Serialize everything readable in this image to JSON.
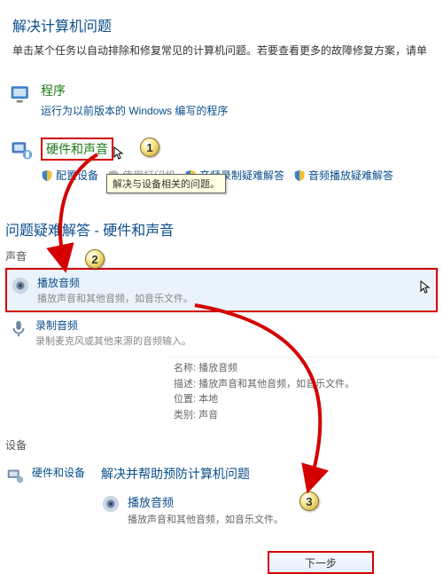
{
  "header": {
    "title": "解决计算机问题",
    "subtitle": "单击某个任务以自动排除和修复常见的计算机问题。若要查看更多的故障修复方案，请单"
  },
  "programs": {
    "title": "程序",
    "desc": "运行为以前版本的 Windows 编写的程序"
  },
  "hardware": {
    "title": "硬件和声音",
    "links": {
      "a": "配置设备",
      "b": "使用打印机",
      "c": "音频录制疑难解答",
      "d": "音频播放疑难解答"
    },
    "tooltip": "解决与设备相关的问题。"
  },
  "panel": {
    "heading": "问题疑难解答 - 硬件和声音",
    "sound_label": "声音",
    "play": {
      "title": "播放音频",
      "desc": "播放声音和其他音频，如音乐文件。"
    },
    "record": {
      "title": "录制音频",
      "desc": "录制麦克风或其他来源的音频输入。"
    },
    "device_label": "设备",
    "hwdev": {
      "title": "硬件和设备"
    },
    "detail": {
      "name_k": "名称:",
      "name_v": "播放音频",
      "desc_k": "描述:",
      "desc_v": "播放声音和其他音频，如音乐文件。",
      "loc_k": "位置:",
      "loc_v": "本地",
      "cat_k": "类别:",
      "cat_v": "声音"
    }
  },
  "wizard": {
    "title": "解决并帮助预防计算机问题",
    "item_title": "播放音频",
    "item_desc": "播放声音和其他音频，如音乐文件。",
    "next": "下一步"
  },
  "badges": {
    "b1": "1",
    "b2": "2",
    "b3": "3"
  }
}
